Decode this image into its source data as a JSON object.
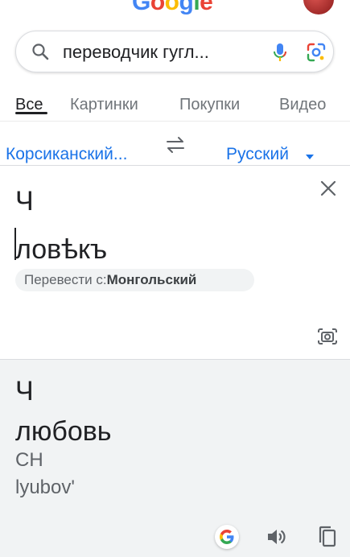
{
  "header": {
    "logo_letters": [
      "G",
      "o",
      "o",
      "g",
      "l",
      "e"
    ],
    "logo_colors": [
      "#4285f4",
      "#ea4335",
      "#fbbc05",
      "#4285f4",
      "#34a853",
      "#ea4335"
    ]
  },
  "search": {
    "query": "переводчик гугл...",
    "icons": [
      "search-icon",
      "mic-icon",
      "lens-icon"
    ]
  },
  "tabs": [
    {
      "label": "Все",
      "active": true
    },
    {
      "label": "Картинки",
      "active": false
    },
    {
      "label": "Покупки",
      "active": false
    },
    {
      "label": "Видео",
      "active": false
    }
  ],
  "translator": {
    "source_language": "Корсиканский...",
    "target_language": "Русский",
    "source_text_lines": [
      "Ч",
      "ловѣкъ"
    ],
    "detect_prefix": "Перевести с:",
    "detect_language": "Монгольский",
    "result_lines": [
      "Ч",
      "любовь"
    ],
    "transliteration_lines": [
      "CH",
      "lyubov'"
    ]
  },
  "colors": {
    "accent": "#1a73e8",
    "result_bg": "#f1f3f4",
    "text": "#202124",
    "muted": "#5f6368"
  }
}
